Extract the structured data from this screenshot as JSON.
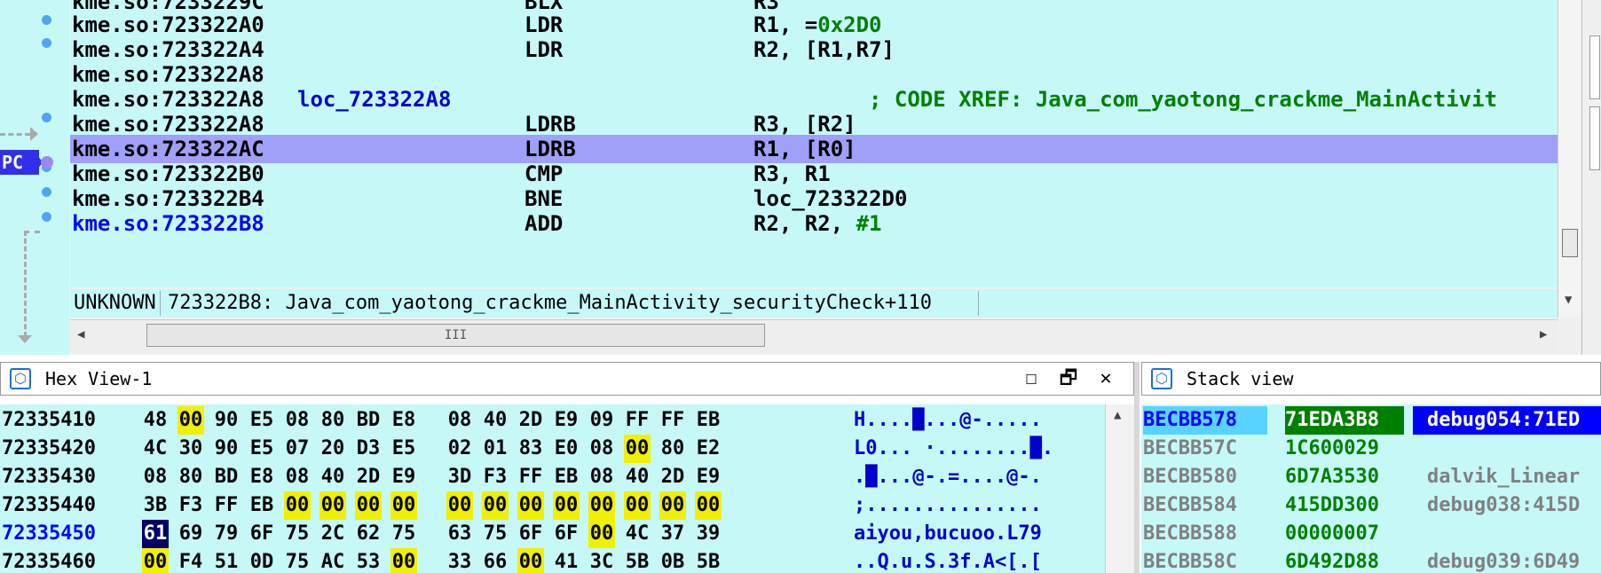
{
  "disassembly": {
    "rows": [
      {
        "addr": "kme.so:7233229C",
        "label": "",
        "mnemonic": "BLX",
        "operands": "R3",
        "comment": ""
      },
      {
        "addr": "kme.so:723322A0",
        "label": "",
        "mnemonic": "LDR",
        "operands": "R1, =",
        "operand_const": "0x2D0",
        "comment": ""
      },
      {
        "addr": "kme.so:723322A4",
        "label": "",
        "mnemonic": "LDR",
        "operands": "R2, [R1,R7]",
        "comment": ""
      },
      {
        "addr": "kme.so:723322A8",
        "label": "",
        "mnemonic": "",
        "operands": "",
        "comment": ""
      },
      {
        "addr": "kme.so:723322A8",
        "label": "loc_723322A8",
        "mnemonic": "",
        "operands": "",
        "comment": "; CODE XREF: Java_com_yaotong_crackme_MainActivit"
      },
      {
        "addr": "kme.so:723322A8",
        "label": "",
        "mnemonic": "LDRB",
        "operands": "R3, [R2]",
        "comment": ""
      },
      {
        "addr": "kme.so:723322AC",
        "label": "",
        "mnemonic": "LDRB",
        "operands": "R1, [R0]",
        "comment": ""
      },
      {
        "addr": "kme.so:723322B0",
        "label": "",
        "mnemonic": "CMP",
        "operands": "R3, R1",
        "comment": ""
      },
      {
        "addr": "kme.so:723322B4",
        "label": "",
        "mnemonic": "BNE",
        "operands": "loc_723322D0",
        "comment": ""
      },
      {
        "addr": "kme.so:723322B8",
        "label": "",
        "mnemonic": "ADD",
        "operands": "R2, R2, ",
        "operand_const": "#1",
        "comment": ""
      }
    ],
    "pc_label": "PC",
    "status": {
      "segment": "UNKNOWN",
      "location": "723322B8: Java_com_yaotong_crackme_MainActivity_securityCheck+110"
    },
    "hscroll_grip": "III"
  },
  "hex_view": {
    "title": "Hex View-1",
    "buttons": {
      "maximize": "☐",
      "restore": "🗗",
      "close": "✕"
    },
    "rows": [
      {
        "addr": "72335410",
        "bytes": [
          "48",
          "00",
          "90",
          "E5",
          "08",
          "80",
          "BD",
          "E8",
          "08",
          "40",
          "2D",
          "E9",
          "09",
          "FF",
          "FF",
          "EB"
        ],
        "ascii": "H....█...@-....."
      },
      {
        "addr": "72335420",
        "bytes": [
          "4C",
          "30",
          "90",
          "E5",
          "07",
          "20",
          "D3",
          "E5",
          "02",
          "01",
          "83",
          "E0",
          "08",
          "00",
          "80",
          "E2"
        ],
        "ascii": "L0... ·........█."
      },
      {
        "addr": "72335430",
        "bytes": [
          "08",
          "80",
          "BD",
          "E8",
          "08",
          "40",
          "2D",
          "E9",
          "3D",
          "F3",
          "FF",
          "EB",
          "08",
          "40",
          "2D",
          "E9"
        ],
        "ascii": ".█...@-.=....@-."
      },
      {
        "addr": "72335440",
        "bytes": [
          "3B",
          "F3",
          "FF",
          "EB",
          "00",
          "00",
          "00",
          "00",
          "00",
          "00",
          "00",
          "00",
          "00",
          "00",
          "00",
          "00"
        ],
        "ascii": ";..............."
      },
      {
        "addr": "72335450",
        "bytes": [
          "61",
          "69",
          "79",
          "6F",
          "75",
          "2C",
          "62",
          "75",
          "63",
          "75",
          "6F",
          "6F",
          "00",
          "4C",
          "37",
          "39"
        ],
        "ascii": "aiyou,bucuoo.L79"
      },
      {
        "addr": "72335460",
        "bytes": [
          "00",
          "F4",
          "51",
          "0D",
          "75",
          "AC",
          "53",
          "00",
          "33",
          "66",
          "00",
          "41",
          "3C",
          "5B",
          "0B",
          "5B"
        ],
        "ascii": "..Q.u.S.3f.A<[.["
      }
    ]
  },
  "stack_view": {
    "title": "Stack view",
    "rows": [
      {
        "addr": "BECBB578",
        "value": "71EDA3B8",
        "comment": "debug054:71ED"
      },
      {
        "addr": "BECBB57C",
        "value": "1C600029",
        "comment": ""
      },
      {
        "addr": "BECBB580",
        "value": "6D7A3530",
        "comment": "dalvik_Linear"
      },
      {
        "addr": "BECBB584",
        "value": "415DD300",
        "comment": "debug038:415D"
      },
      {
        "addr": "BECBB588",
        "value": "00000007",
        "comment": ""
      },
      {
        "addr": "BECBB58C",
        "value": "6D492D88",
        "comment": "debug039:6D49"
      }
    ]
  },
  "colors": {
    "listing_bg": "#c6f8f8",
    "pc_highlight": "#a0a0f8",
    "zero_byte": "#f0f000",
    "selected_byte": "#000066"
  }
}
